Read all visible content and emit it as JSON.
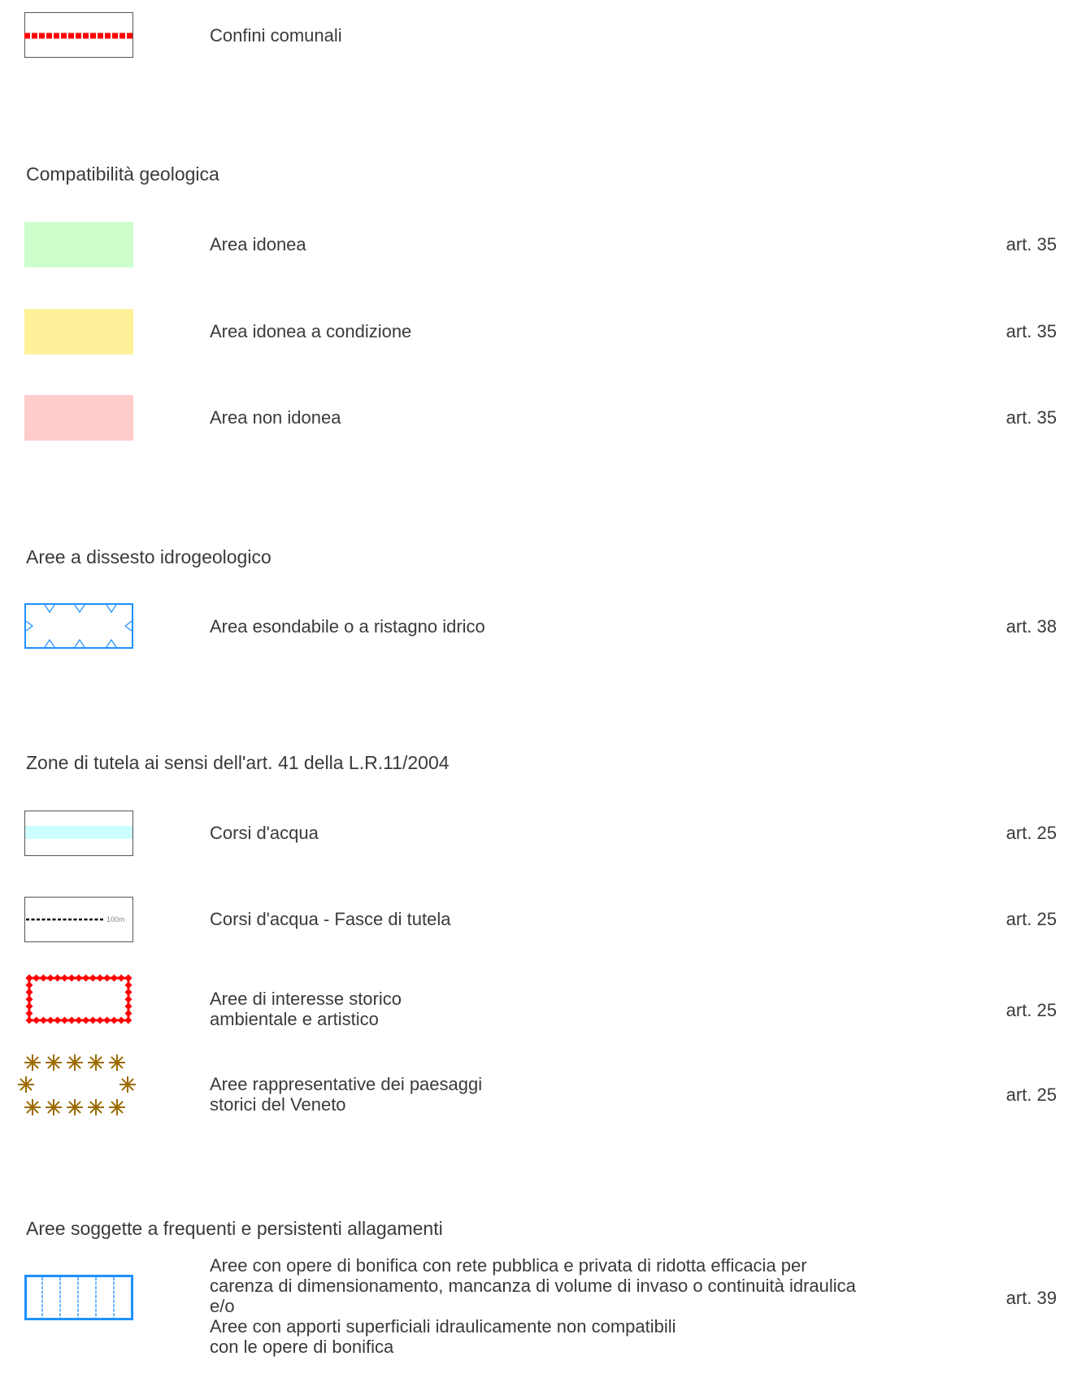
{
  "legend": {
    "boundary": {
      "label": "Confini comunali",
      "color": "#ff0000"
    },
    "geological_compatibility": {
      "title": "Compatibilità geologica",
      "items": [
        {
          "label": "Area idonea",
          "article": "art.  35",
          "color": "#ccffcc"
        },
        {
          "label": "Area idonea a condizione",
          "article": "art.  35",
          "color": "#fff199"
        },
        {
          "label": "Area non idonea",
          "article": "art.  35",
          "color": "#ffcccc"
        }
      ]
    },
    "hydrogeological_instability": {
      "title": "Aree a dissesto idrogeologico",
      "items": [
        {
          "label": "Area esondabile o a ristagno idrico",
          "article": "art.  38",
          "color": "#1e90ff"
        }
      ]
    },
    "protection_zones": {
      "title": "Zone di tutela ai sensi dell'art. 41 della L.R.11/2004",
      "items": [
        {
          "label": "Corsi d'acqua",
          "article": "art.  25",
          "color": "#ccffff"
        },
        {
          "label": "Corsi d'acqua - Fasce di tutela",
          "article": "art.  25",
          "symbol_text": "100m"
        },
        {
          "label": "Aree di interesse storico\nambientale e artistico",
          "article": "art.  25",
          "color": "#ff0000"
        },
        {
          "label": "Aree rappresentative dei paesaggi\nstorici del Veneto",
          "article": "art.  25",
          "color": "#9c6a00"
        }
      ]
    },
    "flooding_areas": {
      "title": "Aree soggette a frequenti e persistenti allagamenti",
      "items": [
        {
          "label": "Aree con opere di bonifica con rete pubblica e privata di ridotta efficacia per\ncarenza di dimensionamento, mancanza di volume di invaso o continuità idraulica\ne/o\nAree con apporti superficiali idraulicamente non compatibili\ncon le opere di bonifica",
          "article": "art.  39",
          "color": "#1e90ff"
        }
      ]
    }
  }
}
